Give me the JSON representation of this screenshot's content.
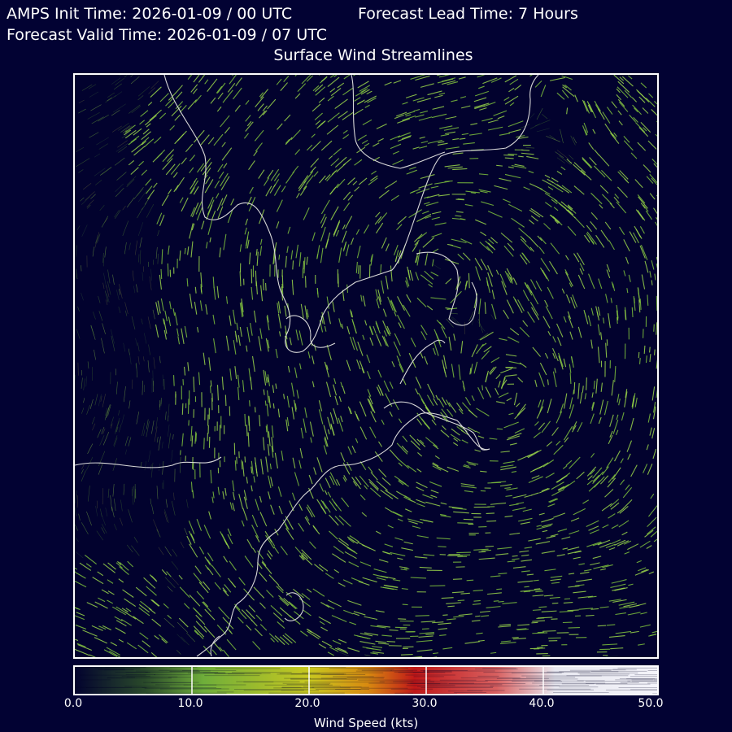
{
  "header": {
    "init_time": "AMPS Init Time: 2026-01-09 / 00 UTC",
    "lead_time": "Forecast Lead Time: 7 Hours",
    "valid_time": "Forecast Valid Time: 2026-01-09 / 07 UTC"
  },
  "map": {
    "title": "Surface Wind Streamlines",
    "background_color": "#020233",
    "coastline_color": "#d8d8d8"
  },
  "colorbar": {
    "label": "Wind Speed (kts)",
    "range": [
      0,
      50
    ],
    "ticks": [
      "0.0",
      "10.0",
      "20.0",
      "30.0",
      "40.0",
      "50.0"
    ],
    "colors": [
      "#02022e",
      "#2a4a2a",
      "#6fae3a",
      "#c8c820",
      "#d88a10",
      "#c01818",
      "#d86060",
      "#e8e8f0"
    ]
  }
}
